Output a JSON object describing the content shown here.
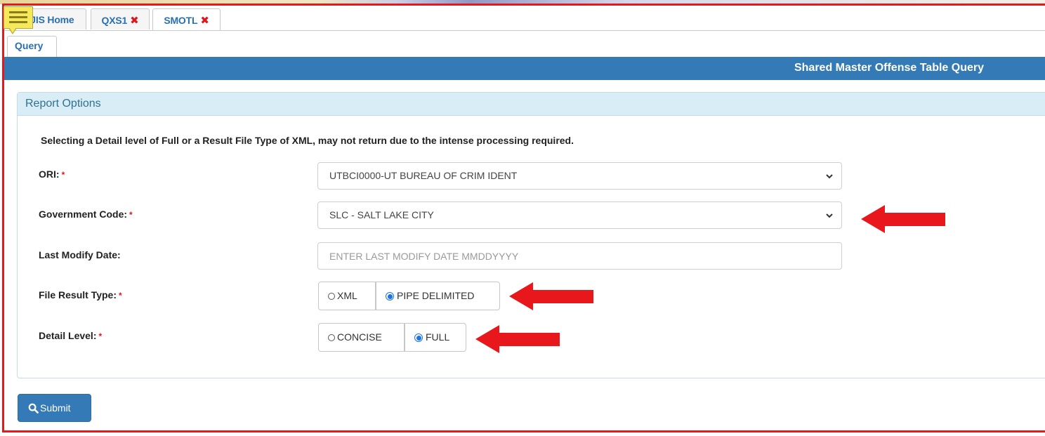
{
  "tabs": [
    {
      "label": "UCJIS Home",
      "closable": false
    },
    {
      "label": "QXS1",
      "closable": true
    },
    {
      "label": "SMOTL",
      "closable": true,
      "active": true
    }
  ],
  "close_glyph": "✖",
  "menu_icon": "hamburger-menu-icon",
  "subtab": {
    "label": "Query"
  },
  "page_header": {
    "title": "Shared Master Offense Table Query"
  },
  "panel": {
    "title": "Report Options"
  },
  "notice": "Selecting a Detail level of Full or a Result File Type of XML, may not return due to the intense processing required.",
  "required_marker": "*",
  "form": {
    "ori": {
      "label": "ORI:",
      "value": "UTBCI0000-UT BUREAU OF CRIM IDENT"
    },
    "government_code": {
      "label": "Government Code:",
      "value": "SLC - SALT LAKE CITY"
    },
    "last_modify_date": {
      "label": "Last Modify Date:",
      "placeholder": "ENTER LAST MODIFY DATE MMDDYYYY",
      "value": ""
    },
    "file_result_type": {
      "label": "File Result Type:",
      "options": [
        "XML",
        "PIPE DELIMITED"
      ],
      "selected": "PIPE DELIMITED"
    },
    "detail_level": {
      "label": "Detail Level:",
      "options": [
        "CONCISE",
        "FULL"
      ],
      "selected": "FULL"
    }
  },
  "submit": {
    "label": "Submit",
    "icon": "search-icon"
  },
  "colors": {
    "primary": "#337ab7",
    "panel_heading": "#d9edf7",
    "annotation_red": "#e8171c",
    "required": "#e3141b"
  }
}
